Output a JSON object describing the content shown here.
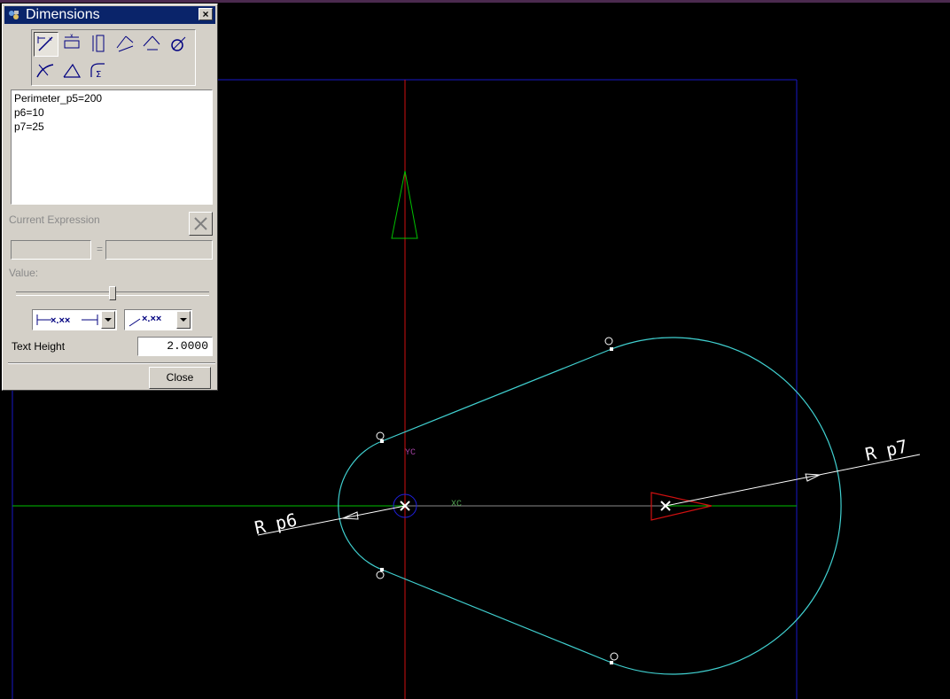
{
  "dialog": {
    "title": "Dimensions",
    "close_glyph": "×",
    "toolbar_icons": [
      "inferred-dimension-icon",
      "horizontal-dimension-icon",
      "vertical-dimension-icon",
      "parallel-dimension-icon",
      "perpendicular-dimension-icon",
      "diameter-dimension-icon",
      "radius-dimension-icon",
      "angular-dimension-icon",
      "perimeter-dimension-icon"
    ],
    "expressions": [
      "Perimeter_p5=200",
      "p6=10",
      "p7=25"
    ],
    "current_expression_label": "Current Expression",
    "equals_sign": "=",
    "value_label": "Value:",
    "slider_level": 0.5,
    "placement_option": "×.××",
    "leader_option": "×.××",
    "text_height_label": "Text Height",
    "text_height_value": "2.0000",
    "close_label": "Close"
  },
  "sketch": {
    "labels": {
      "yc": "YC",
      "xc": "XC",
      "radius_small": "R p6",
      "radius_large": "R p7",
      "point_marker": "O"
    },
    "colors": {
      "background": "#000000",
      "profile": "#40d0d0",
      "x_axis": "#00c000",
      "y_axis": "#d01010",
      "frame": "#1010c0",
      "dimension": "#ffffff",
      "axis_label_x": "#50a050",
      "axis_label_y": "#a040a0"
    }
  }
}
